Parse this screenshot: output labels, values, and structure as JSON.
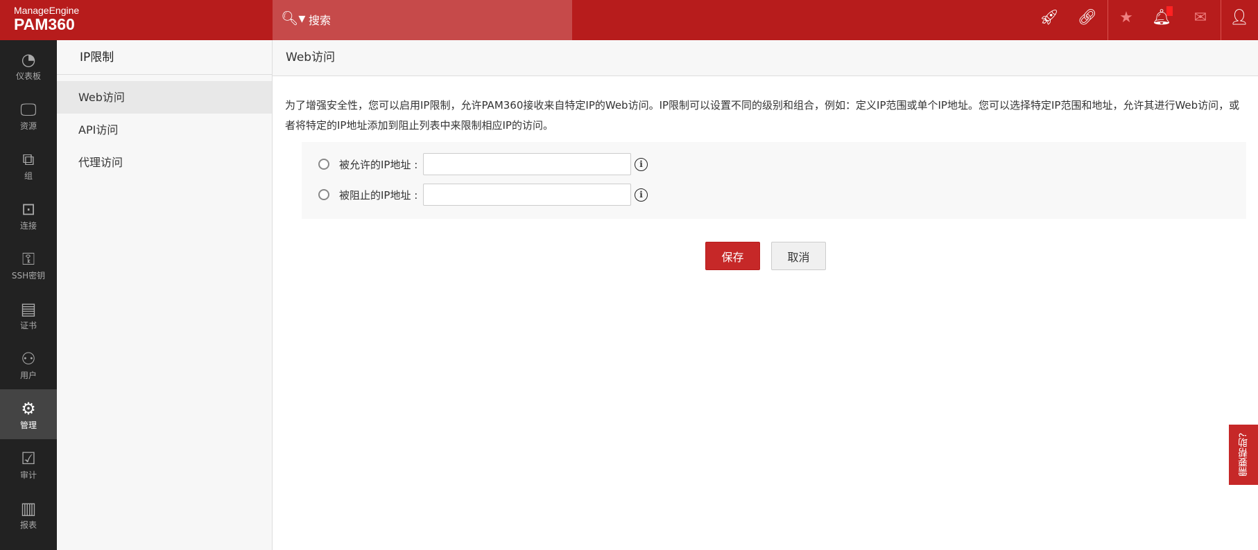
{
  "header": {
    "brand": "ManageEngine",
    "product": "PAM360",
    "search_placeholder": "搜索"
  },
  "sidebar": {
    "items": [
      {
        "label": "仪表板",
        "icon": "dashboard-icon",
        "glyph": "◔"
      },
      {
        "label": "资源",
        "icon": "monitor-icon",
        "glyph": "🖵"
      },
      {
        "label": "组",
        "icon": "group-icon",
        "glyph": "⧉"
      },
      {
        "label": "连接",
        "icon": "connection-icon",
        "glyph": "⊡"
      },
      {
        "label": "SSH密钥",
        "icon": "ssh-key-icon",
        "glyph": "⚿"
      },
      {
        "label": "证书",
        "icon": "certificate-icon",
        "glyph": "▤"
      },
      {
        "label": "用户",
        "icon": "user-icon",
        "glyph": "⚇"
      },
      {
        "label": "管理",
        "icon": "gear-icon",
        "glyph": "⚙"
      },
      {
        "label": "审计",
        "icon": "clipboard-icon",
        "glyph": "☑"
      },
      {
        "label": "报表",
        "icon": "bar-chart-icon",
        "glyph": "▥"
      }
    ]
  },
  "subnav": {
    "title": "IP限制",
    "items": [
      "Web访问",
      "API访问",
      "代理访问"
    ]
  },
  "content": {
    "title": "Web访问",
    "description": "为了增强安全性，您可以启用IP限制，允许PAM360接收来自特定IP的Web访问。IP限制可以设置不同的级别和组合，例如：定义IP范围或单个IP地址。您可以选择特定IP范围和地址，允许其进行Web访问，或者将特定的IP地址添加到阻止列表中来限制相应IP的访问。",
    "allowed_label": "被允许的IP地址 :",
    "allowed_value": "",
    "blocked_label": "被阻止的IP地址 :",
    "blocked_value": "",
    "save": "保存",
    "cancel": "取消"
  },
  "help": "需要帮助?",
  "colors": {
    "header": "#b71c1c",
    "accent": "#c62828",
    "sidebar": "#222222"
  }
}
